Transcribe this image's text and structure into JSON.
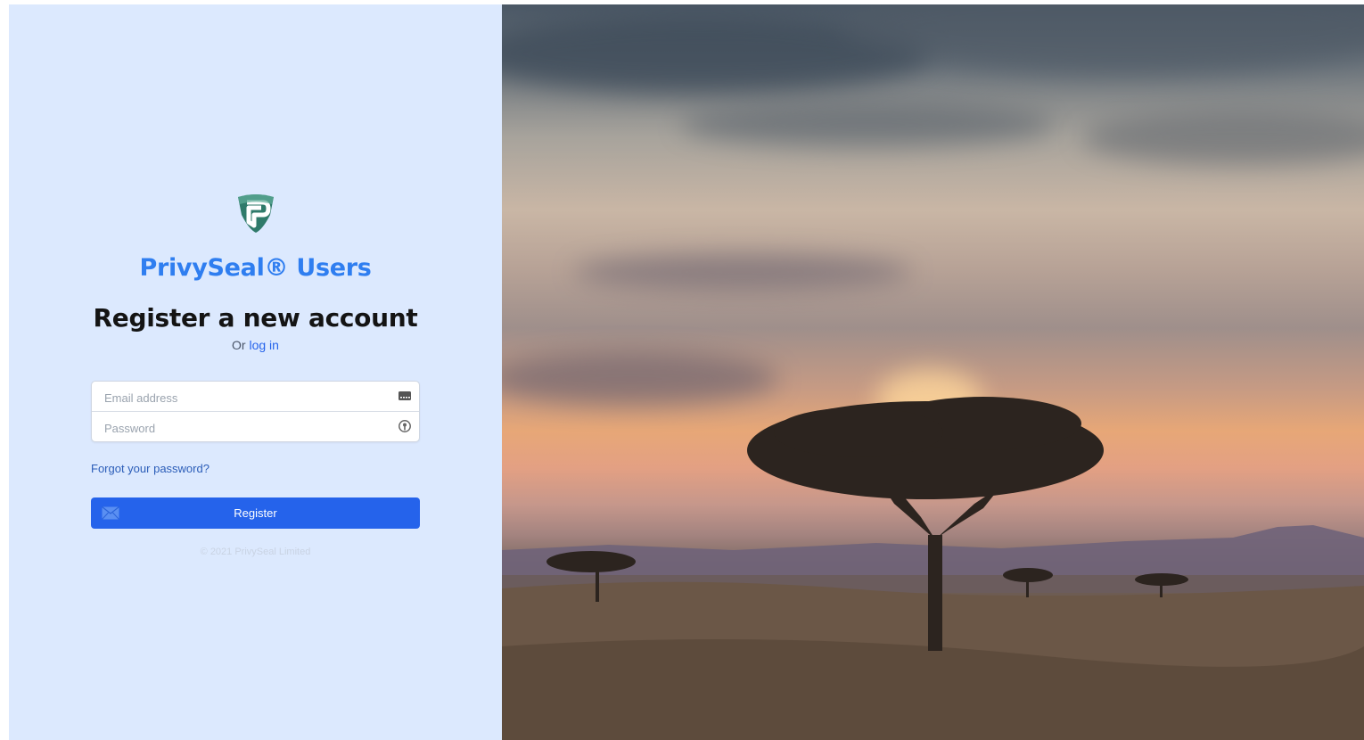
{
  "brand": {
    "name": "PrivySeal® Users",
    "logo_icon": "privyseal-shield-logo",
    "color": "#2f7ef0"
  },
  "form": {
    "heading": "Register a new account",
    "alt_prefix": "Or",
    "alt_link": "log in",
    "email": {
      "placeholder": "Email address",
      "value": "",
      "icon": "card-icon"
    },
    "password": {
      "placeholder": "Password",
      "value": "",
      "icon": "key-icon"
    },
    "forgot_link": "Forgot your password?",
    "submit_label": "Register",
    "submit_icon": "envelope-icon",
    "accent": "#2563eb"
  },
  "footer": {
    "copyright": "© 2021 PrivySeal Limited"
  },
  "hero": {
    "description_icon": "savanna-sunset-image"
  }
}
